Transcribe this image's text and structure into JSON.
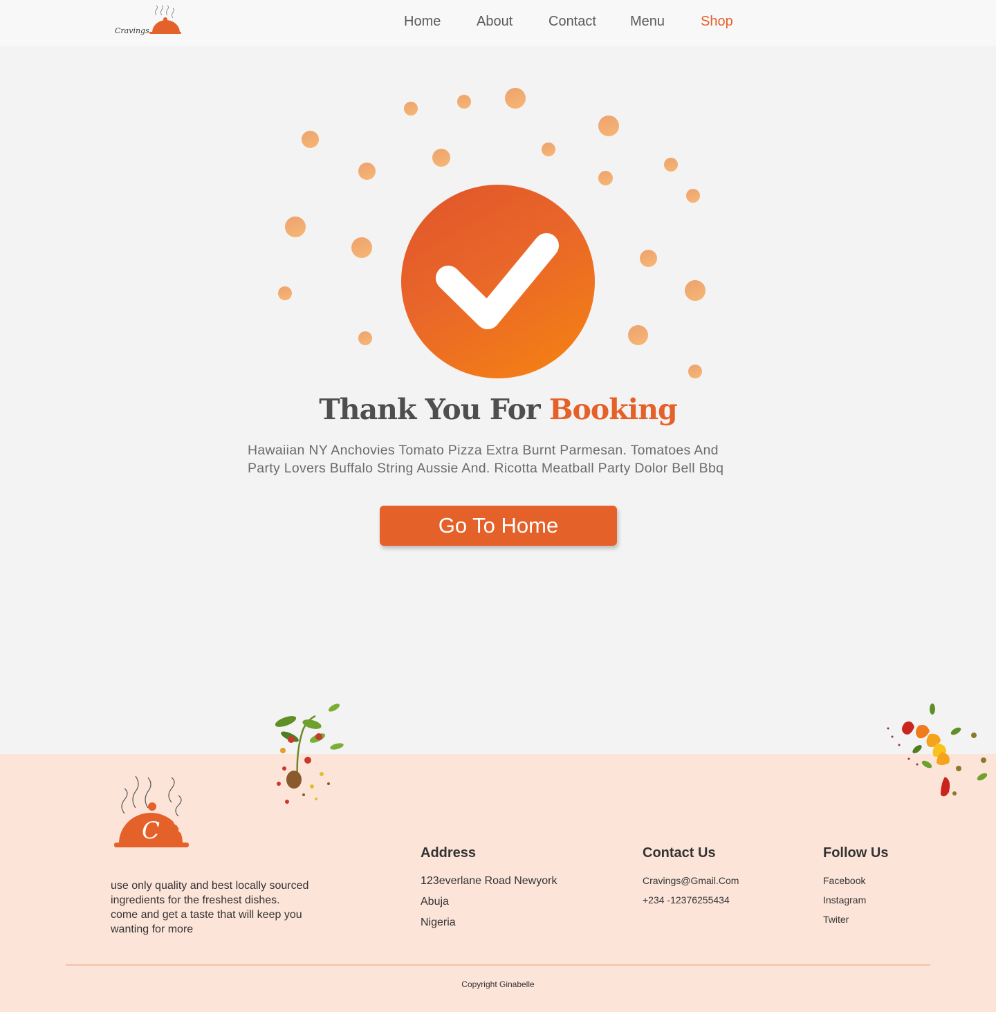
{
  "header": {
    "logo_text": "Cravings",
    "nav": [
      {
        "label": "Home",
        "active": false
      },
      {
        "label": "About",
        "active": false
      },
      {
        "label": "Contact",
        "active": false
      },
      {
        "label": "Menu",
        "active": false
      },
      {
        "label": "Shop",
        "active": true
      }
    ]
  },
  "hero": {
    "title_main": "Thank You For",
    "title_accent": "Booking",
    "description": "Hawaiian NY Anchovies Tomato Pizza Extra Burnt Parmesan. Tomatoes And Party Lovers Buffalo String Aussie And. Ricotta Meatball Party Dolor Bell Bbq",
    "cta_label": "Go To Home"
  },
  "footer": {
    "logo_letter": "C",
    "tagline": "use only quality and best locally sourced ingredients for the freshest dishes.\ncome and get a taste that will keep you wanting for more",
    "address": {
      "heading": "Address",
      "lines": [
        "123everlane Road Newyork",
        "Abuja",
        "Nigeria"
      ]
    },
    "contact": {
      "heading": "Contact Us",
      "lines": [
        "Cravings@Gmail.Com",
        "+234 -12376255434"
      ]
    },
    "follow": {
      "heading": "Follow Us",
      "links": [
        "Facebook",
        "Instagram",
        "Twiter"
      ]
    },
    "copyright": "Copyright Ginabelle"
  },
  "colors": {
    "accent": "#e4612a",
    "footer_bg": "#fde4d9",
    "page_bg": "#f3f3f3",
    "dot": "#f0a76f"
  }
}
